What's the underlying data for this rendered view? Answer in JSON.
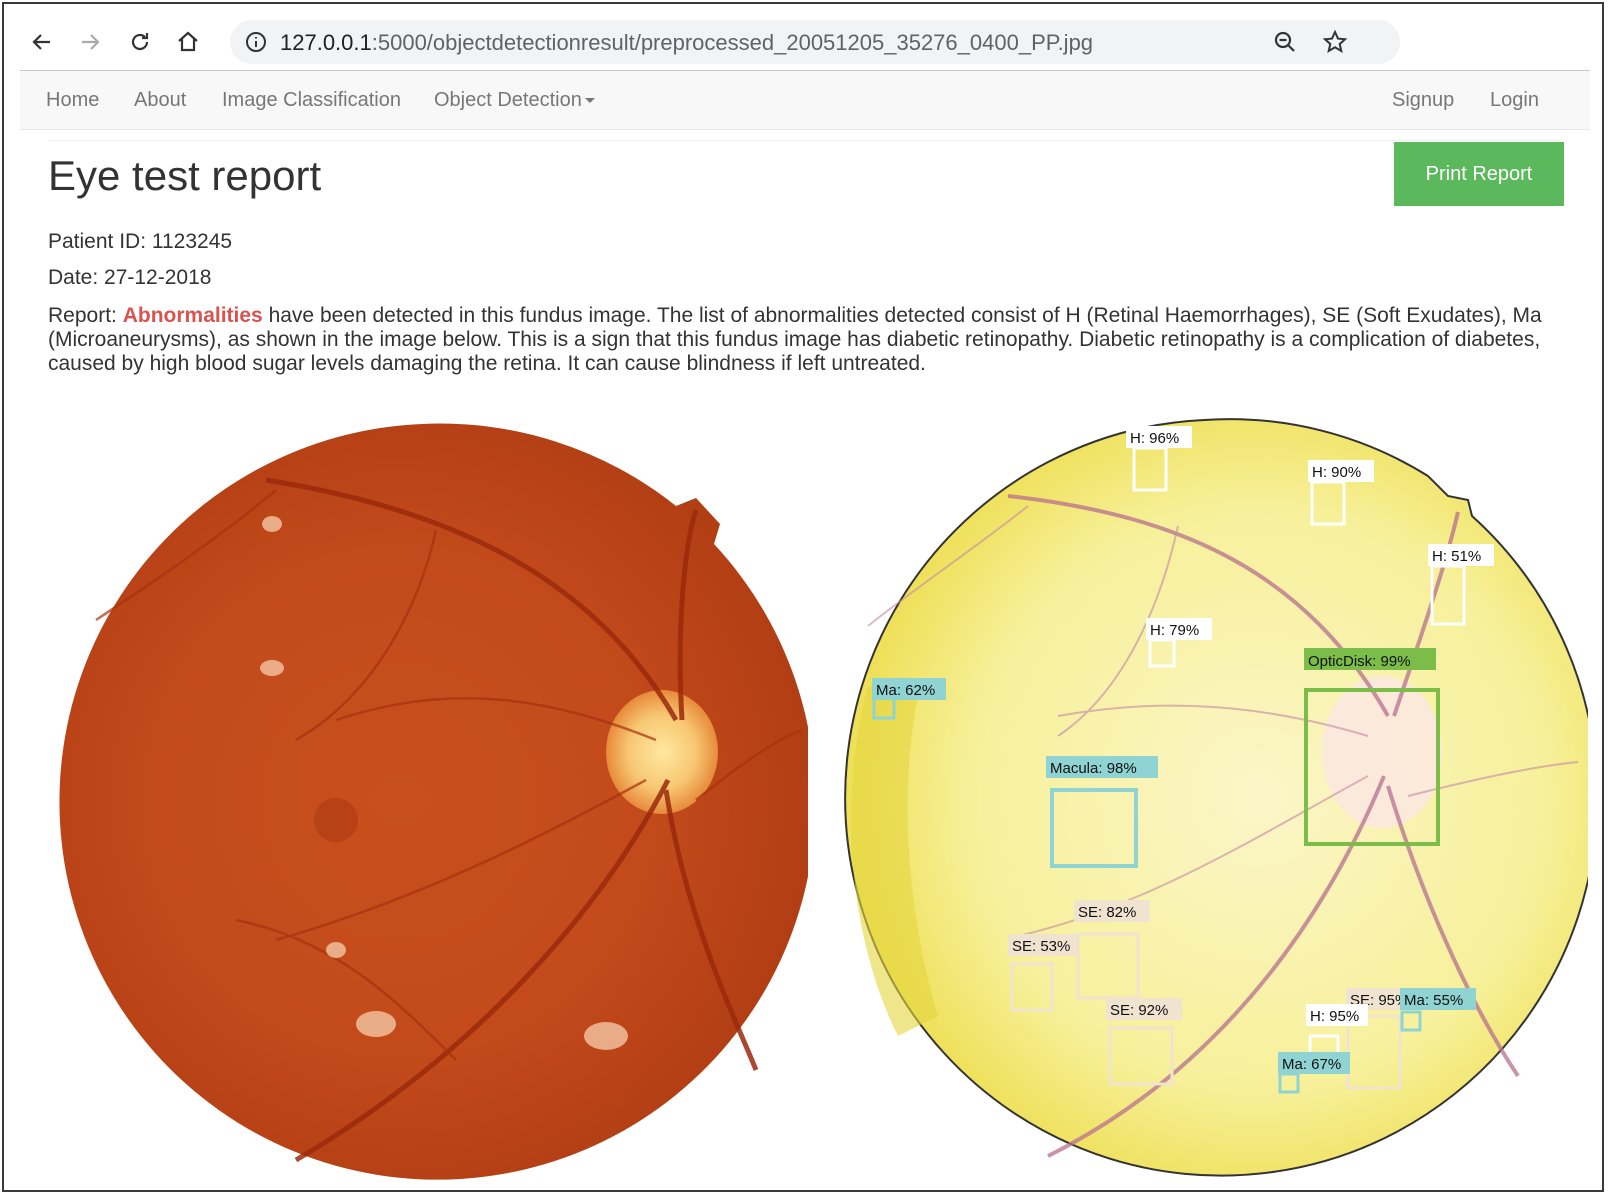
{
  "browser": {
    "url_host": "127.0.0.1",
    "url_rest": ":5000/objectdetectionresult/preprocessed_20051205_35276_0400_PP.jpg"
  },
  "nav": {
    "home": "Home",
    "about": "About",
    "image_classification": "Image Classification",
    "object_detection": "Object Detection",
    "signup": "Signup",
    "login": "Login"
  },
  "report": {
    "title": "Eye test report",
    "print_label": "Print Report",
    "patient_id": "Patient ID: 1123245",
    "date": "Date: 27-12-2018",
    "report_prefix": "Report: ",
    "abnormalities": "Abnormalities",
    "report_text": " have been detected in this fundus image. The list of abnormalities detected consist of H (Retinal Haemorrhages), SE (Soft Exudates), Ma (Microaneurysms), as shown in the image below. This is a sign that this fundus image has diabetic retinopathy. Diabetic retinopathy is a complication of diabetes, caused by high blood sugar levels damaging the retina. It can cause blindness if left untreated."
  },
  "detections": [
    {
      "label": "H: 96%",
      "color": "#ffffff"
    },
    {
      "label": "H: 90%",
      "color": "#ffffff"
    },
    {
      "label": "H: 51%",
      "color": "#ffffff"
    },
    {
      "label": "H: 79%",
      "color": "#ffffff"
    },
    {
      "label": "OpticDisk: 99%",
      "color": "#7cbd4a"
    },
    {
      "label": "Ma: 62%",
      "color": "#8fd3d3"
    },
    {
      "label": "Macula: 98%",
      "color": "#8fd3d3"
    },
    {
      "label": "SE: 82%",
      "color": "#f0e3d0"
    },
    {
      "label": "SE: 53%",
      "color": "#f0e3d0"
    },
    {
      "label": "SE: 92%",
      "color": "#f0e3d0"
    },
    {
      "label": "SE: 95%",
      "color": "#f0e3d0"
    },
    {
      "label": "H: 95%",
      "color": "#ffffff"
    },
    {
      "label": "Ma: 55%",
      "color": "#8fd3d3"
    },
    {
      "label": "Ma: 67%",
      "color": "#8fd3d3"
    }
  ],
  "icons": [
    "back-icon",
    "forward-icon",
    "reload-icon",
    "home-icon",
    "info-icon",
    "zoom-out-icon",
    "bookmark-star-icon"
  ]
}
